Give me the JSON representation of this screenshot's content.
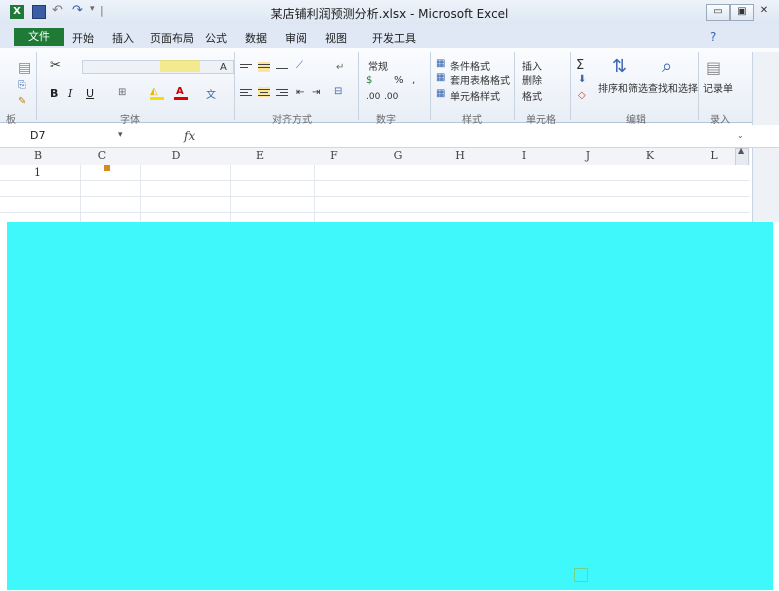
{
  "app": {
    "window_title": "某店铺利润预测分析.xlsx - Microsoft Excel",
    "app_icon_letter": "X",
    "window_buttons": [
      "▭",
      "▣",
      "✕"
    ]
  },
  "ribbon": {
    "tabs": [
      "文件",
      "开始",
      "插入",
      "页面布局",
      "公式",
      "数据",
      "审阅",
      "视图",
      "开发工具"
    ],
    "font_buttons": [
      "B",
      "I",
      "U"
    ],
    "number_format": "常规",
    "percent": "%",
    "comma": ",",
    "decimal_increase": ".00",
    "decimal_decrease": ".00",
    "styles": [
      "条件格式",
      "套用表格格式",
      "单元格样式"
    ],
    "cells": [
      "插入",
      "删除",
      "格式"
    ],
    "editing": [
      "排序和筛选",
      "查找和选择"
    ],
    "record": "记录单",
    "group_labels": [
      "板",
      "字体",
      "对齐方式",
      "数字",
      "样式",
      "单元格",
      "编辑",
      "录入"
    ]
  },
  "formula_bar": {
    "name_box": "D7",
    "fx": "fx"
  },
  "sheet": {
    "columns": [
      "B",
      "C",
      "D",
      "E",
      "F",
      "G",
      "H",
      "I",
      "J",
      "K",
      "L"
    ],
    "row1_label": "1"
  }
}
